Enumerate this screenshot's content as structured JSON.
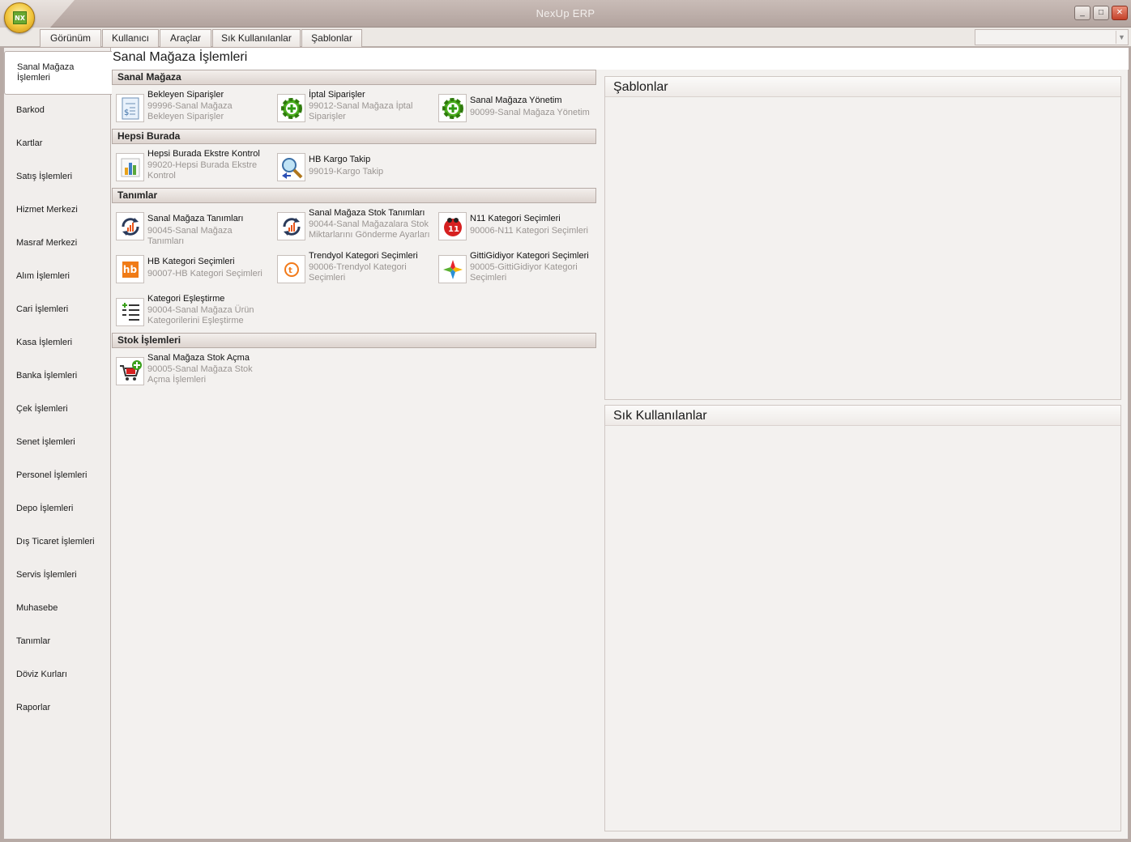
{
  "window": {
    "title": "NexUp ERP",
    "orb_label": "NX"
  },
  "menu": {
    "tabs": [
      {
        "label": "Görünüm"
      },
      {
        "label": "Kullanıcı"
      },
      {
        "label": "Araçlar"
      },
      {
        "label": "Sık Kullanılanlar"
      },
      {
        "label": "Şablonlar"
      }
    ],
    "search_value": ""
  },
  "sidebar": {
    "items": [
      {
        "label": "Sanal Mağaza İşlemleri",
        "active": true
      },
      {
        "label": "Barkod"
      },
      {
        "label": "Kartlar"
      },
      {
        "label": "Satış İşlemleri"
      },
      {
        "label": "Hizmet Merkezi"
      },
      {
        "label": "Masraf Merkezi"
      },
      {
        "label": "Alım İşlemleri"
      },
      {
        "label": "Cari İşlemleri"
      },
      {
        "label": "Kasa İşlemleri"
      },
      {
        "label": "Banka İşlemleri"
      },
      {
        "label": "Çek İşlemleri"
      },
      {
        "label": "Senet İşlemleri"
      },
      {
        "label": "Personel İşlemleri"
      },
      {
        "label": "Depo İşlemleri"
      },
      {
        "label": "Dış Ticaret İşlemleri"
      },
      {
        "label": "Servis İşlemleri"
      },
      {
        "label": "Muhasebe"
      },
      {
        "label": "Tanımlar"
      },
      {
        "label": "Döviz Kurları"
      },
      {
        "label": "Raporlar"
      }
    ]
  },
  "main": {
    "title": "Sanal Mağaza İşlemleri",
    "groups": [
      {
        "header": "Sanal Mağaza",
        "tiles": [
          {
            "title": "Bekleyen Siparişler",
            "sub": "99996-Sanal Mağaza Bekleyen Siparişler",
            "icon": "document-icon"
          },
          {
            "title": "İptal Siparişler",
            "sub": "99012-Sanal Mağaza İptal Siparişler",
            "icon": "green-gear-icon"
          },
          {
            "title": "Sanal Mağaza Yönetim",
            "sub": "90099-Sanal Mağaza Yönetim",
            "icon": "green-gear-icon"
          }
        ]
      },
      {
        "header": "Hepsi Burada",
        "tiles": [
          {
            "title": "Hepsi Burada Ekstre Kontrol",
            "sub": "99020-Hepsi Burada Ekstre Kontrol",
            "icon": "bar-chart-icon"
          },
          {
            "title": "HB Kargo Takip",
            "sub": "99019-Kargo Takip",
            "icon": "magnifier-icon"
          }
        ]
      },
      {
        "header": "Tanımlar",
        "tiles": [
          {
            "title": "Sanal Mağaza Tanımları",
            "sub": "90045-Sanal Mağaza Tanımları",
            "icon": "sync-chart-icon"
          },
          {
            "title": "Sanal Mağaza Stok Tanımları",
            "sub": "90044-Sanal Mağazalara Stok Miktarlarını Gönderme Ayarları",
            "icon": "sync-chart-icon"
          },
          {
            "title": "N11 Kategori Seçimleri",
            "sub": "90006-N11 Kategori Seçimleri",
            "icon": "n11-logo-icon"
          },
          {
            "title": "HB Kategori Seçimleri",
            "sub": "90007-HB Kategori Seçimleri",
            "icon": "hb-logo-icon"
          },
          {
            "title": "Trendyol Kategori Seçimleri",
            "sub": "90006-Trendyol Kategori Seçimleri",
            "icon": "trendyol-logo-icon"
          },
          {
            "title": "GittiGidiyor Kategori Seçimleri",
            "sub": "90005-GittiGidiyor Kategori Seçimleri",
            "icon": "gittigidiyor-logo-icon"
          },
          {
            "title": "Kategori Eşleştirme",
            "sub": "90004-Sanal Mağaza Ürün Kategorilerini Eşleştirme",
            "icon": "add-list-icon"
          }
        ]
      },
      {
        "header": "Stok İşlemleri",
        "tiles": [
          {
            "title": "Sanal Mağaza Stok Açma",
            "sub": "90005-Sanal Mağaza Stok Açma İşlemleri",
            "icon": "cart-add-icon"
          }
        ]
      }
    ]
  },
  "panels": {
    "templates_title": "Şablonlar",
    "favorites_title": "Sık Kullanılanlar"
  },
  "colors": {
    "titlebar": "#b8aaa5",
    "accent_green": "#4caf1f",
    "hb_orange": "#f07b16"
  }
}
